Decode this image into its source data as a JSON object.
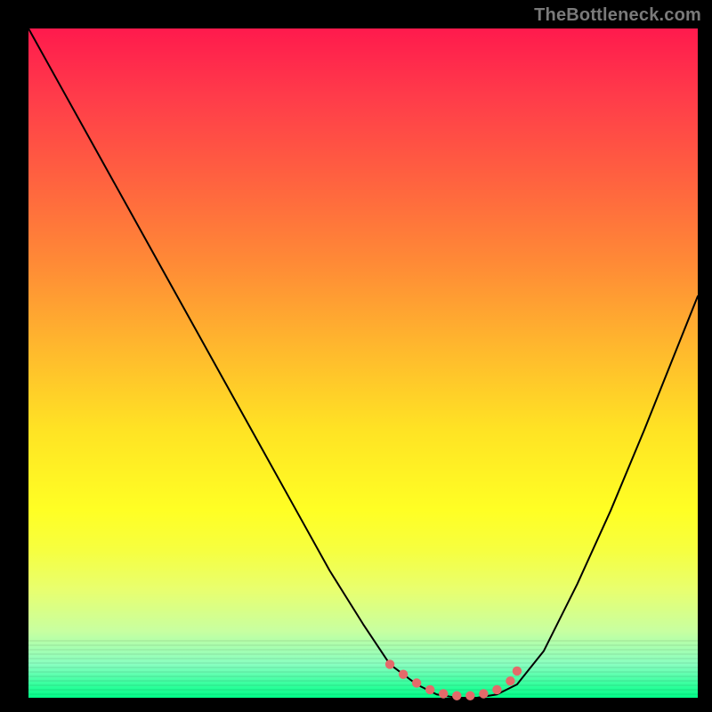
{
  "watermark": "TheBottleneck.com",
  "colors": {
    "frame": "#000000",
    "curve": "#000000",
    "marker": "#e46a6a"
  },
  "chart_data": {
    "type": "line",
    "title": "",
    "xlabel": "",
    "ylabel": "",
    "xlim": [
      0,
      100
    ],
    "ylim": [
      0,
      100
    ],
    "grid": false,
    "legend": false,
    "series": [
      {
        "name": "bottleneck-curve",
        "x": [
          0,
          5,
          10,
          15,
          20,
          25,
          30,
          35,
          40,
          45,
          50,
          54,
          58,
          61,
          64,
          67,
          70,
          73,
          77,
          82,
          87,
          92,
          96,
          100
        ],
        "values": [
          100,
          91,
          82,
          73,
          64,
          55,
          46,
          37,
          28,
          19,
          11,
          5,
          2,
          0.5,
          0,
          0,
          0.5,
          2,
          7,
          17,
          28,
          40,
          50,
          60
        ]
      }
    ],
    "markers": {
      "name": "highlight-dots",
      "color": "#e46a6a",
      "x": [
        54,
        56,
        58,
        60,
        62,
        64,
        66,
        68,
        70,
        72,
        73
      ],
      "values": [
        5,
        3.5,
        2.2,
        1.2,
        0.6,
        0.3,
        0.3,
        0.6,
        1.2,
        2.5,
        4
      ]
    }
  }
}
